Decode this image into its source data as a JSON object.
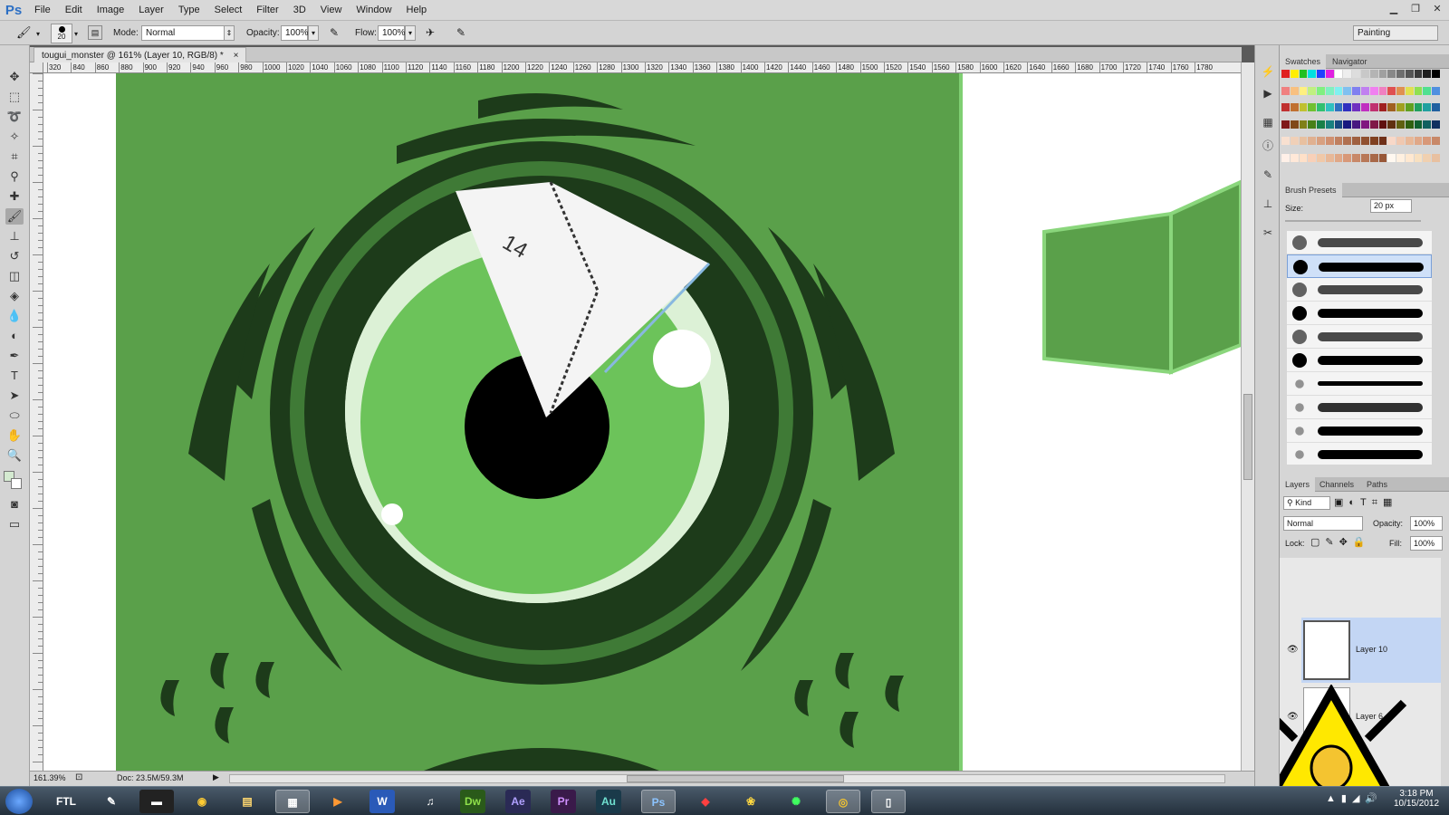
{
  "app": {
    "logo": "Ps"
  },
  "menu": [
    "File",
    "Edit",
    "Image",
    "Layer",
    "Type",
    "Select",
    "Filter",
    "3D",
    "View",
    "Window",
    "Help"
  ],
  "options": {
    "brush_size": "20",
    "mode_label": "Mode:",
    "mode_value": "Normal",
    "opacity_label": "Opacity:",
    "opacity_value": "100%",
    "flow_label": "Flow:",
    "flow_value": "100%",
    "workspace": "Painting"
  },
  "document": {
    "tab_title": "tougui_monster @ 161% (Layer 10, RGB/8) *",
    "close": "×",
    "zoom": "161.39%",
    "doc_size": "Doc: 23.5M/59.3M",
    "canvas_annotation": "14"
  },
  "ruler_ticks": [
    "320",
    "840",
    "860",
    "880",
    "900",
    "920",
    "940",
    "960",
    "980",
    "1000",
    "1020",
    "1040",
    "1060",
    "1080",
    "1100",
    "1120",
    "1140",
    "1160",
    "1180",
    "1200",
    "1220",
    "1240",
    "1260",
    "1280",
    "1300",
    "1320",
    "1340",
    "1360",
    "1380",
    "1400",
    "1420",
    "1440",
    "1460",
    "1480",
    "1500",
    "1520",
    "1540",
    "1560",
    "1580",
    "1600",
    "1620",
    "1640",
    "1660",
    "1680",
    "1700",
    "1720",
    "1740",
    "1760",
    "1780"
  ],
  "swatches_panel": {
    "tabs": [
      "Swatches",
      "Navigator"
    ]
  },
  "brush_presets": {
    "title": "Brush Presets",
    "size_label": "Size:",
    "size_value": "20 px"
  },
  "layers_panel": {
    "tabs": [
      "Layers",
      "Channels",
      "Paths"
    ],
    "kind": "Kind",
    "blend_mode": "Normal",
    "opacity_label": "Opacity:",
    "opacity_value": "100%",
    "lock_label": "Lock:",
    "fill_label": "Fill:",
    "fill_value": "100%",
    "layers": [
      {
        "name": "Layer 10",
        "selected": true
      },
      {
        "name": "Layer 6",
        "selected": false
      }
    ]
  },
  "taskbar": {
    "apps": [
      "FTL",
      "Dw",
      "Ae",
      "Pr",
      "Au",
      "Ps",
      "W"
    ],
    "clock_time": "3:18 PM",
    "clock_date": "10/15/2012"
  },
  "colors": {
    "canvas_green": "#5aa04a",
    "dark_green": "#1d3b1a",
    "iris_green": "#6cc35a",
    "sclera": "#d8f0d2",
    "accent_blue": "#2c6fc4"
  }
}
